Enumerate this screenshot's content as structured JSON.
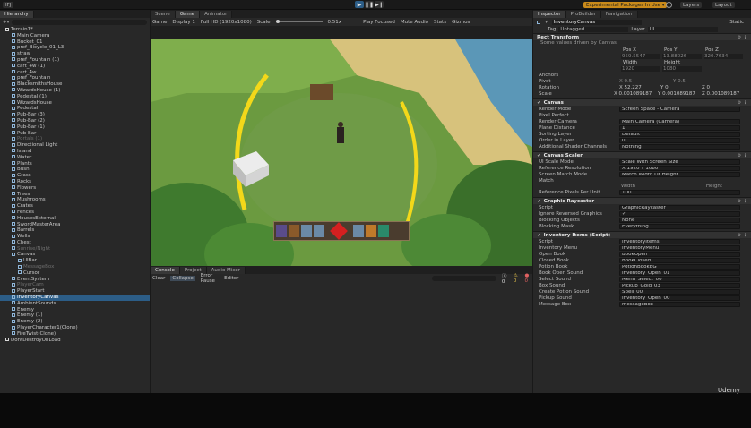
{
  "topbar": {
    "account": "IFJ",
    "play": "▶",
    "pause": "❚❚",
    "step": "▶❙",
    "packages": "Experimental Packages In Use ▾",
    "layers": "Layers",
    "layout": "Layout"
  },
  "hierarchy": {
    "tab": "Hierarchy",
    "items": [
      {
        "label": "Terrain1*",
        "indent": 0,
        "state": "normal"
      },
      {
        "label": "Main Camera",
        "indent": 1,
        "state": "normal"
      },
      {
        "label": "Bucket_01",
        "indent": 1,
        "state": "normal"
      },
      {
        "label": "pref_Bicycle_01_L3",
        "indent": 1,
        "state": "normal"
      },
      {
        "label": "straw",
        "indent": 1,
        "state": "normal"
      },
      {
        "label": "pref_Fountain (1)",
        "indent": 1,
        "state": "normal"
      },
      {
        "label": "cart_4w (1)",
        "indent": 1,
        "state": "normal"
      },
      {
        "label": "cart_4w",
        "indent": 1,
        "state": "normal"
      },
      {
        "label": "pref_Fountain",
        "indent": 1,
        "state": "normal"
      },
      {
        "label": "BlacksmithsHouse",
        "indent": 1,
        "state": "normal"
      },
      {
        "label": "WizardsHouse (1)",
        "indent": 1,
        "state": "normal"
      },
      {
        "label": "Pedestal (1)",
        "indent": 1,
        "state": "normal"
      },
      {
        "label": "WizardsHouse",
        "indent": 1,
        "state": "normal"
      },
      {
        "label": "Pedestal",
        "indent": 1,
        "state": "normal"
      },
      {
        "label": "Pub-Bar (3)",
        "indent": 1,
        "state": "normal"
      },
      {
        "label": "Pub-Bar (2)",
        "indent": 1,
        "state": "normal"
      },
      {
        "label": "Pub-Bar (1)",
        "indent": 1,
        "state": "normal"
      },
      {
        "label": "Pub-Bar",
        "indent": 1,
        "state": "normal"
      },
      {
        "label": "Portals (1)",
        "indent": 1,
        "state": "dim"
      },
      {
        "label": "Directional Light",
        "indent": 1,
        "state": "normal"
      },
      {
        "label": "Island",
        "indent": 1,
        "state": "normal"
      },
      {
        "label": "Water",
        "indent": 1,
        "state": "normal"
      },
      {
        "label": "Plants",
        "indent": 1,
        "state": "normal"
      },
      {
        "label": "Bush",
        "indent": 1,
        "state": "normal"
      },
      {
        "label": "Grass",
        "indent": 1,
        "state": "normal"
      },
      {
        "label": "Rocks",
        "indent": 1,
        "state": "normal"
      },
      {
        "label": "Flowers",
        "indent": 1,
        "state": "normal"
      },
      {
        "label": "Trees",
        "indent": 1,
        "state": "normal"
      },
      {
        "label": "Mushrooms",
        "indent": 1,
        "state": "normal"
      },
      {
        "label": "Crates",
        "indent": 1,
        "state": "normal"
      },
      {
        "label": "Fences",
        "indent": 1,
        "state": "normal"
      },
      {
        "label": "HousesExternal",
        "indent": 1,
        "state": "normal"
      },
      {
        "label": "SwordMasterArea",
        "indent": 1,
        "state": "normal"
      },
      {
        "label": "Barrels",
        "indent": 1,
        "state": "normal"
      },
      {
        "label": "Wells",
        "indent": 1,
        "state": "normal"
      },
      {
        "label": "Chest",
        "indent": 1,
        "state": "normal"
      },
      {
        "label": "Sunrise/Night",
        "indent": 1,
        "state": "dim"
      },
      {
        "label": "Canvas",
        "indent": 1,
        "state": "normal"
      },
      {
        "label": "UIBar",
        "indent": 2,
        "state": "normal"
      },
      {
        "label": "MessageBox",
        "indent": 2,
        "state": "dim"
      },
      {
        "label": "Cursor",
        "indent": 2,
        "state": "normal"
      },
      {
        "label": "EventSystem",
        "indent": 1,
        "state": "normal"
      },
      {
        "label": "PlayerCam",
        "indent": 1,
        "state": "dim"
      },
      {
        "label": "PlayerStart",
        "indent": 1,
        "state": "normal"
      },
      {
        "label": "InventoryCanvas",
        "indent": 1,
        "state": "sel"
      },
      {
        "label": "AmbientSounds",
        "indent": 1,
        "state": "normal"
      },
      {
        "label": "Enemy",
        "indent": 1,
        "state": "normal"
      },
      {
        "label": "Enemy (1)",
        "indent": 1,
        "state": "normal"
      },
      {
        "label": "Enemy (2)",
        "indent": 1,
        "state": "normal"
      },
      {
        "label": "PlayerCharacter1(Clone)",
        "indent": 1,
        "state": "normal"
      },
      {
        "label": "FireTwist(Clone)",
        "indent": 1,
        "state": "normal"
      },
      {
        "label": "DontDestroyOnLoad",
        "indent": 0,
        "state": "normal"
      }
    ]
  },
  "game": {
    "tabs": [
      "Scene",
      "Game",
      "Animator"
    ],
    "display": "Game",
    "display_num": "Display 1",
    "resolution": "Full HD (1920x1080)",
    "scale_label": "Scale",
    "scale_value": "0.51x",
    "play_focused": "Play Focused",
    "mute": "Mute Audio",
    "stats": "Stats",
    "gizmos": "Gizmos"
  },
  "console": {
    "tabs": [
      "Console",
      "Project",
      "Audio Mixer"
    ],
    "buttons": [
      "Clear",
      "Collapse",
      "Error Pause",
      "Editor"
    ],
    "counts": [
      "0",
      "0",
      "0"
    ]
  },
  "inspector": {
    "tabs": [
      "Inspector",
      "ProBuilder",
      "Navigation"
    ],
    "object_name": "InventoryCanvas",
    "static": "Static",
    "tag_label": "Tag",
    "tag": "Untagged",
    "layer_label": "Layer",
    "layer": "UI",
    "rect_transform": {
      "title": "Rect Transform",
      "note": "Some values driven by Canvas.",
      "cols": [
        "Pos X",
        "Pos Y",
        "Pos Z"
      ],
      "vals": [
        "959.5547",
        "13.88026",
        "320.7634"
      ],
      "w_label": "Width",
      "h_label": "Height",
      "w": "1920",
      "h": "1080",
      "anchors": "Anchors",
      "pivot_label": "Pivot",
      "pivot_x": "0.5",
      "pivot_y": "0.5",
      "rotation_label": "Rotation",
      "rot": [
        "X 52.227",
        "Y 0",
        "Z 0"
      ],
      "scale_label": "Scale",
      "scale": [
        "X 0.001089187",
        "Y 0.001089187",
        "Z 0.001089187"
      ]
    },
    "canvas": {
      "title": "Canvas",
      "props": [
        [
          "Render Mode",
          "Screen Space - Camera"
        ],
        [
          "Pixel Perfect",
          ""
        ],
        [
          "Render Camera",
          "Main Camera (Camera)"
        ],
        [
          "Plane Distance",
          "1"
        ],
        [
          "Sorting Layer",
          "Default"
        ],
        [
          "Order in Layer",
          "0"
        ],
        [
          "Additional Shader Channels",
          "Nothing"
        ]
      ]
    },
    "scaler": {
      "title": "Canvas Scaler",
      "props": [
        [
          "UI Scale Mode",
          "Scale With Screen Size"
        ],
        [
          "Reference Resolution",
          "X 1920   Y 1080"
        ],
        [
          "Screen Match Mode",
          "Match Width Or Height"
        ],
        [
          "Match",
          ""
        ],
        [
          "Reference Pixels Per Unit",
          "100"
        ]
      ],
      "width_label": "Width",
      "height_label": "Height"
    },
    "raycaster": {
      "title": "Graphic Raycaster",
      "props": [
        [
          "Script",
          "GraphicRaycaster"
        ],
        [
          "Ignore Reversed Graphics",
          "✓"
        ],
        [
          "Blocking Objects",
          "None"
        ],
        [
          "Blocking Mask",
          "Everything"
        ]
      ]
    },
    "inventory": {
      "title": "Inventory Items (Script)",
      "props": [
        [
          "Script",
          "InventoryItems"
        ],
        [
          "Inventory Menu",
          "InventoryMenu"
        ],
        [
          "Open Book",
          "BookOpen"
        ],
        [
          "Closed Book",
          "BookClosed"
        ],
        [
          "Potion Book",
          "PotionBookBG"
        ],
        [
          "Book Open Sound",
          "Inventory_Open_01"
        ],
        [
          "Select Sound",
          "Menu_Select_00"
        ],
        [
          "Box Sound",
          "Pickup_Gold_03"
        ],
        [
          "Create Potion Sound",
          "Spell_00"
        ],
        [
          "Pickup Sound",
          "Inventory_Open_00"
        ],
        [
          "Message Box",
          "messageBox"
        ]
      ]
    }
  },
  "watermark": "Udemy"
}
